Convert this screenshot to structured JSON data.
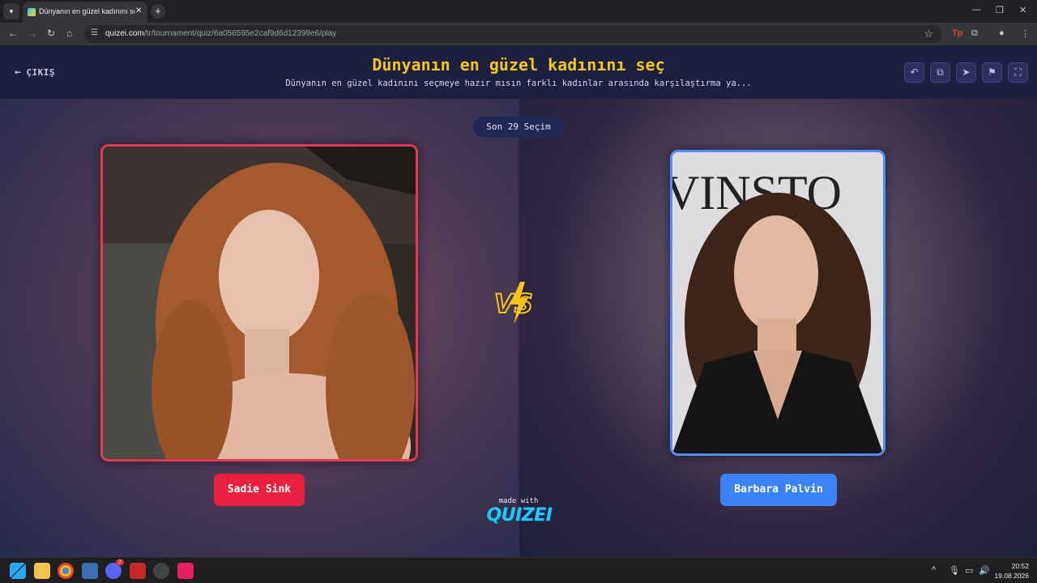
{
  "browser": {
    "tab_title": "Dünyanın en güzel kadınını seç",
    "url_host": "quizei.com",
    "url_path": "/tr/tournament/quiz/6a056595e2caf9d6d12399e6/play"
  },
  "header": {
    "exit_label": "ÇIKIŞ",
    "title": "Dünyanın en güzel kadınını seç",
    "description": "Dünyanın en güzel kadınını seçmeye hazır mısın farklı kadınlar arasında karşılaştırma ya..."
  },
  "round_badge": "Son 29 Seçim",
  "left_choice": {
    "name": "Sadie Sink",
    "accent": "#e8203d"
  },
  "right_choice": {
    "name": "Barbara Palvin",
    "accent": "#3b82f6"
  },
  "vs_label": "VS",
  "footer": {
    "made_with": "made with",
    "brand": "QUIZEI"
  },
  "taskbar": {
    "time": "20:52",
    "date": "19.08.2026",
    "discord_badge": "7"
  }
}
